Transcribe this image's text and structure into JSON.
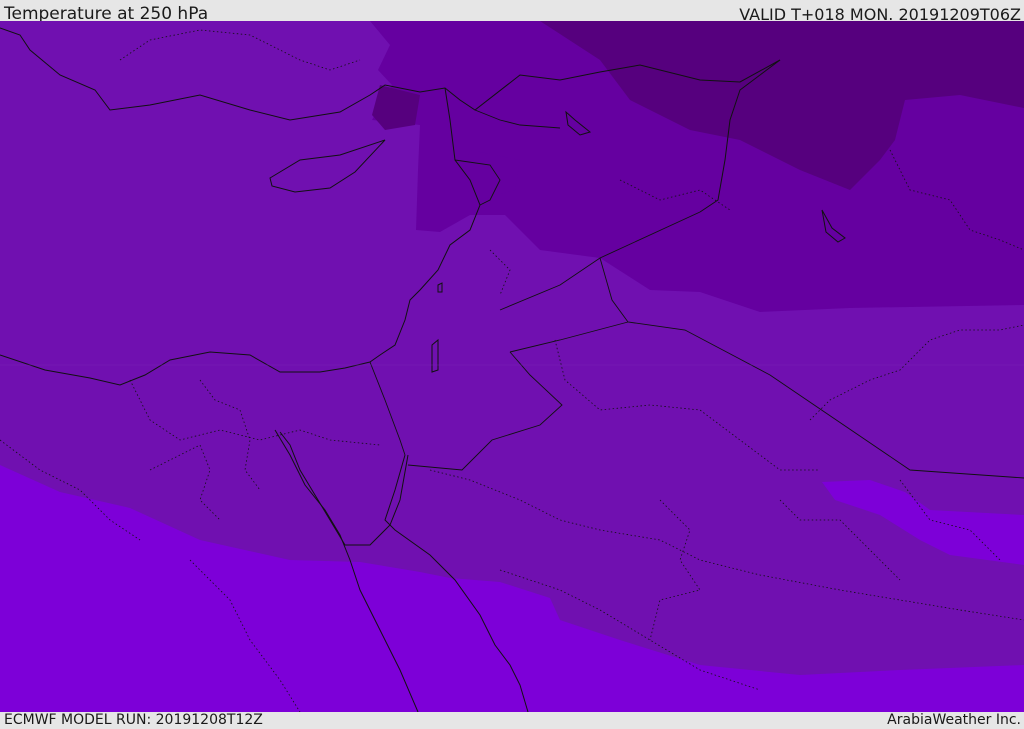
{
  "header": {
    "title": "Temperature at 250 hPa",
    "valid": "VALID T+018 MON. 20191209T06Z"
  },
  "footer": {
    "model_run": "ECMWF MODEL RUN: 20191208T12Z",
    "credit": "ArabiaWeather Inc."
  },
  "colors": {
    "bg_purple": "#7010b0",
    "dark_purple": "#6500a0",
    "darkest_purple": "#56007e",
    "bright_violet": "#7d00d8",
    "border_line": "#111111"
  }
}
